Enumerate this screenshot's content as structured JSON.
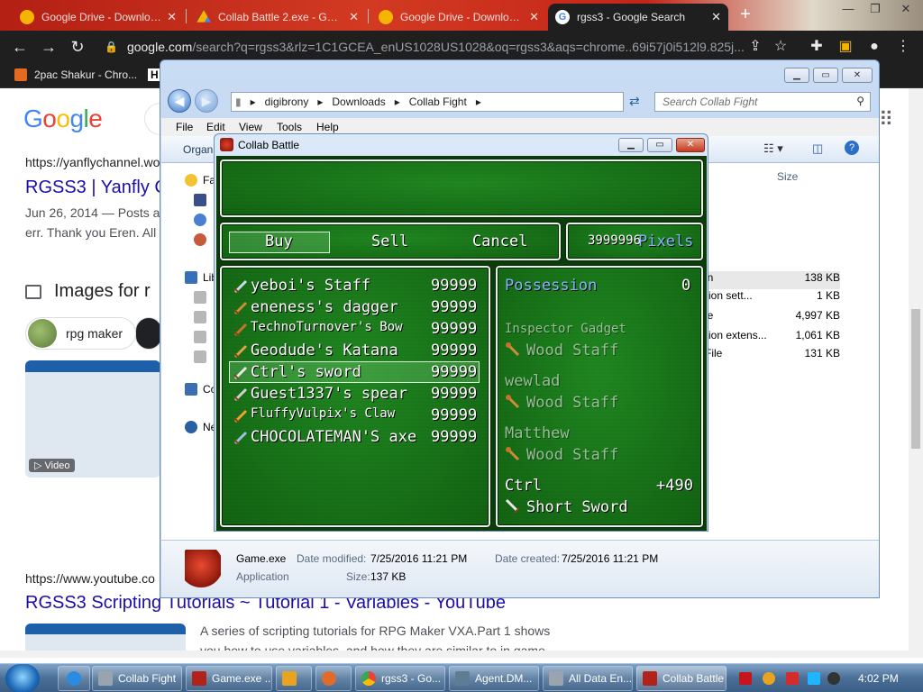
{
  "browser": {
    "tabs": [
      {
        "title": "Google Drive - Downloads"
      },
      {
        "title": "Collab Battle 2.exe - Google"
      },
      {
        "title": "Google Drive - Downloads"
      },
      {
        "title": "rgss3 - Google Search"
      }
    ],
    "url_host": "google.com",
    "url_path": "/search?q=rgss3&rlz=1C1GCEA_enUS1028US1028&oq=rgss3&aqs=chrome..69i57j0i512l9.825j...",
    "bookmarks": [
      {
        "label": "2pac Shakur - Chro..."
      },
      {
        "label": "H"
      }
    ]
  },
  "google": {
    "logo": "Google",
    "result1": {
      "cite": "https://yanflychannel.wo",
      "title": "RGSS3 | Yanfly C",
      "snippet1": "Jun 26, 2014 — Posts a",
      "snippet2": "err. Thank you Eren. All"
    },
    "images_header": "Images for r",
    "chip1": "rpg maker",
    "video_badge": "▷ Video",
    "result2": {
      "cite": "https://www.youtube.co",
      "title": "RGSS3 Scripting Tutorials ~ Tutorial 1 - Variables - YouTube",
      "snippet1": "A series of scripting tutorials for RPG Maker VXA.Part 1 shows",
      "snippet2": "you how to use variables, and how they are similar to in game"
    }
  },
  "explorer": {
    "breadcrumb": [
      "digibrony",
      "Downloads",
      "Collab Fight"
    ],
    "search_placeholder": "Search Collab Fight",
    "menu": [
      "File",
      "Edit",
      "View",
      "Tools",
      "Help"
    ],
    "organize": "Organi",
    "size_header": "Size",
    "nav_items": [
      "Fa",
      "Lib",
      "Co",
      "Ne"
    ],
    "files": [
      {
        "type": "er",
        "size": ""
      },
      {
        "type": "er",
        "size": ""
      },
      {
        "type": "er",
        "size": ""
      },
      {
        "type": "er",
        "size": ""
      },
      {
        "type": "tion",
        "size": "138 KB"
      },
      {
        "type": "ration sett...",
        "size": "1 KB"
      },
      {
        "type": "File",
        "size": "4,997 KB"
      },
      {
        "type": "ration extens...",
        "size": "1,061 KB"
      },
      {
        "type": "2 File",
        "size": "131 KB"
      }
    ],
    "details": {
      "name": "Game.exe",
      "kind": "Application",
      "modified_label": "Date modified:",
      "modified": "7/25/2016 11:21 PM",
      "created_label": "Date created:",
      "created": "7/25/2016 11:21 PM",
      "size_label": "Size:",
      "size": "137 KB"
    }
  },
  "game": {
    "window_title": "Collab Battle",
    "commands": [
      "Buy",
      "Sell",
      "Cancel"
    ],
    "gold_value": "3999996",
    "gold_unit": "Pixels",
    "items": [
      {
        "name": "yeboi's Staff",
        "price": "99999",
        "icon": "staff-icon"
      },
      {
        "name": "eneness's dagger",
        "price": "99999",
        "icon": "dagger-icon"
      },
      {
        "name": "TechnoTurnover's Bow",
        "price": "99999",
        "icon": "bow-icon"
      },
      {
        "name": "Geodude's Katana",
        "price": "99999",
        "icon": "katana-icon"
      },
      {
        "name": "Ctrl's sword",
        "price": "99999",
        "icon": "sword-icon"
      },
      {
        "name": "Guest1337's spear",
        "price": "99999",
        "icon": "spear-icon"
      },
      {
        "name": "FluffyVulpix's Claw",
        "price": "99999",
        "icon": "claw-icon"
      },
      {
        "name": "CHOCOLATEMAN'S axe",
        "price": "99999",
        "icon": "axe-icon"
      }
    ],
    "selected_index": 4,
    "status": {
      "possession_label": "Possession",
      "possession_value": "0",
      "actors": [
        {
          "name": "Inspector Gadget",
          "equip": "Wood Staff",
          "delta": ""
        },
        {
          "name": "wewlad",
          "equip": "Wood Staff",
          "delta": ""
        },
        {
          "name": "Matthew",
          "equip": "Wood Staff",
          "delta": ""
        },
        {
          "name": "Ctrl",
          "equip": "Short Sword",
          "delta": "+490"
        }
      ]
    }
  },
  "taskbar": {
    "items": [
      {
        "label": "Collab Fight"
      },
      {
        "label": "Game.exe ..."
      },
      {
        "label": ""
      },
      {
        "label": ""
      },
      {
        "label": "rgss3 - Go..."
      },
      {
        "label": "Agent.DM..."
      },
      {
        "label": "All Data En..."
      },
      {
        "label": "Collab Battle"
      }
    ],
    "clock": "4:02 PM"
  }
}
